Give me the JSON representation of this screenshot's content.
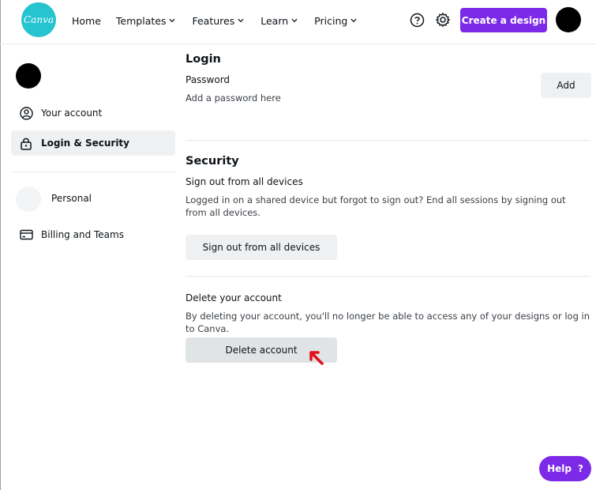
{
  "brand": {
    "logo_text": "Canva",
    "accent_color": "#7d2ae8",
    "logo_color": "#25c4cf"
  },
  "nav": {
    "home": "Home",
    "templates": "Templates",
    "features": "Features",
    "learn": "Learn",
    "pricing": "Pricing"
  },
  "header_actions": {
    "help_icon": "question-circle-icon",
    "settings_icon": "gear-icon",
    "create_label": "Create a design"
  },
  "sidebar": {
    "items": [
      {
        "label": "Your account",
        "icon": "user-circle-icon"
      },
      {
        "label": "Login & Security",
        "icon": "lock-icon",
        "active": true
      }
    ],
    "team": {
      "label": "Personal"
    },
    "billing": {
      "label": "Billing and Teams",
      "icon": "credit-card-icon"
    }
  },
  "login": {
    "title": "Login",
    "password_label": "Password",
    "password_hint": "Add a password here",
    "add_label": "Add"
  },
  "security": {
    "title": "Security",
    "signout_title": "Sign out from all devices",
    "signout_desc": "Logged in on a shared device but forgot to sign out? End all sessions by signing out from all devices.",
    "signout_button": "Sign out from all devices"
  },
  "delete": {
    "title": "Delete your account",
    "desc": "By deleting your account, you'll no longer be able to access any of your designs or log in to Canva.",
    "button": "Delete account"
  },
  "help": {
    "label": "Help",
    "mark": "?"
  }
}
